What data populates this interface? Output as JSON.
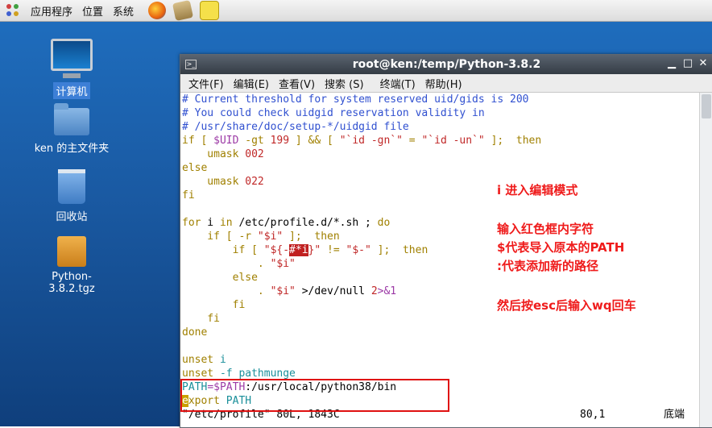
{
  "panel": {
    "menus": [
      "应用程序",
      "位置",
      "系统"
    ],
    "launchers": [
      "firefox-icon",
      "mail-icon",
      "notes-icon"
    ]
  },
  "desktop": {
    "icons": [
      {
        "label": "计算机",
        "icon": "computer-icon"
      },
      {
        "label": "ken 的主文件夹",
        "icon": "home-folder-icon"
      },
      {
        "label": "回收站",
        "icon": "trash-icon"
      },
      {
        "label": "Python-3.8.2.tgz",
        "icon": "archive-icon"
      }
    ]
  },
  "window": {
    "title": "root@ken:/temp/Python-3.8.2",
    "controls": {
      "minimize": "▁",
      "maximize": "□",
      "close": "✕"
    },
    "menu": [
      "文件(F)",
      "编辑(E)",
      "查看(V)",
      "搜索 (S)",
      "终端(T)",
      "帮助(H)"
    ]
  },
  "terminal": {
    "lines": {
      "l1": "# Current threshold for system reserved uid/gids is 200",
      "l2": "# You could check uidgid reservation validity in",
      "l3": "# /usr/share/doc/setup-*/uidgid file",
      "l4a": "if [ ",
      "l4b": "$UID",
      "l4c": " -gt ",
      "l4d": "199",
      "l4e": " ] && [ ",
      "l4f": "\"`id -gn`\"",
      "l4g": " = ",
      "l4h": "\"`id -un`\"",
      "l4i": " ];  ",
      "l4j": "then",
      "l5a": "    umask ",
      "l5b": "002",
      "l6": "else",
      "l7a": "    umask ",
      "l7b": "022",
      "l8": "fi",
      "l10a": "for",
      "l10b": " i ",
      "l10c": "in",
      "l10d": " /etc/profile.d/*.sh ; ",
      "l10e": "do",
      "l11a": "    if [ -r ",
      "l11b": "\"$i\"",
      "l11c": " ];  ",
      "l11d": "then",
      "l12a": "        if [ ",
      "l12b": "\"${-",
      "l12c": "#*i",
      "l12d": "}\"",
      "l12e": " != ",
      "l12f": "\"$-\"",
      "l12g": " ];  ",
      "l12h": "then",
      "l13a": "            . ",
      "l13b": "\"$i\"",
      "l14": "        else",
      "l15a": "            . ",
      "l15b": "\"$i\"",
      "l15c": " >/dev/null ",
      "l15d": "2",
      "l15e": ">&1",
      "l16": "        fi",
      "l17": "    fi",
      "l18": "done",
      "l20a": "unset",
      "l20b": " i",
      "l21a": "unset",
      "l21b": " -f pathmunge",
      "l22a": "PATH",
      "l22b": "=$PATH",
      "l22c": ":/usr/local/python38/bin",
      "l23a": "e",
      "l23b": "xport",
      "l23c": " PATH"
    },
    "status_left": "\"/etc/profile\" 80L, 1843C",
    "status_pos": "80,1",
    "status_right": "底端"
  },
  "annotations": [
    "i 进入编辑模式",
    "输入红色框内字符",
    "$代表导入原本的PATH",
    ":代表添加新的路径",
    "然后按esc后输入wq回车"
  ],
  "colors": {
    "annotation": "#ef1b1b",
    "comment": "#3050d0",
    "keyword": "#a08000",
    "string": "#c02828"
  }
}
